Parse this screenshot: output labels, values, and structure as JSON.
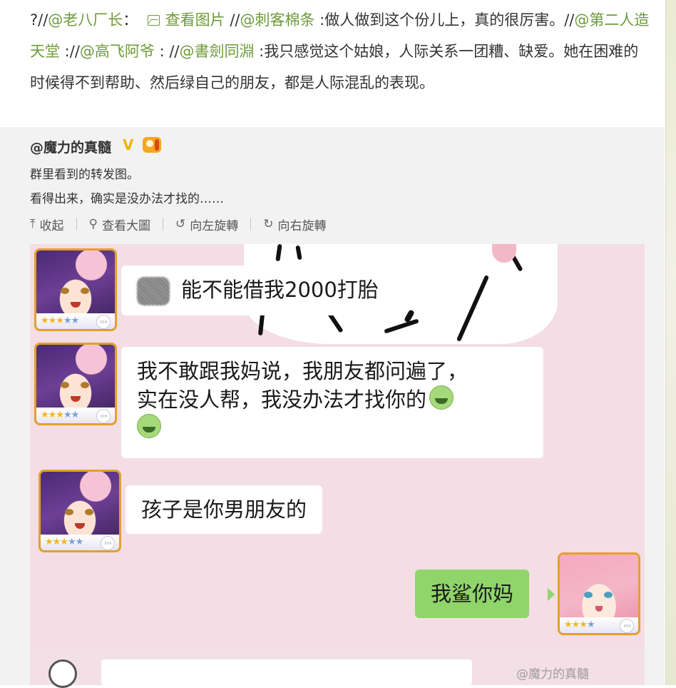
{
  "repost": {
    "prefix": "?//",
    "user1": "@老八厂长",
    "colon1": "：",
    "pic_link": "查看图片",
    "slash2": " //",
    "user2": "@刺客棉条",
    "text2": " :做人做到这个份儿上，真的很厉害。",
    "slash3": "//",
    "user3": "@第二人造天堂",
    "colon3": " ://",
    "user4": "@高飞阿爷",
    "colon4": " : //",
    "user5": "@書劍同淵",
    "text5": " :我只感觉这个姑娘，人际关系一团糟、缺爱。她在困难的时候得不到帮助、然后绿自己的朋友，都是人际混乱的表现。"
  },
  "original": {
    "username": "@魔力的真髓",
    "verified_badge": "V",
    "line1": "群里看到的转发图。",
    "line2": "看得出来，确实是没办法才找的……"
  },
  "toolbar": {
    "collapse": "收起",
    "view_large": "查看大圖",
    "rotate_left": "向左旋轉",
    "rotate_right": "向右旋轉"
  },
  "chat": {
    "messages": [
      {
        "side": "left",
        "text": "能不能借我2000打胎",
        "redacted_prefix": true
      },
      {
        "side": "left",
        "line1": "我不敢跟我妈说，我朋友都问遍了，",
        "line2": "实在没人帮，我没办法才找你的"
      },
      {
        "side": "left",
        "text": "孩子是你男朋友的"
      },
      {
        "side": "right",
        "text": "我鲨你妈"
      }
    ],
    "watermark": "@魔力的真髓"
  },
  "colors": {
    "link": "#6e9a3a",
    "chat_bg": "#f4dde4",
    "bubble_self": "#8fd56a",
    "avatar_border": "#e2a12b",
    "badge": "#f2b200"
  },
  "icons": [
    "image-icon",
    "collapse-arrow-icon",
    "magnifier-icon",
    "rotate-left-icon",
    "rotate-right-icon",
    "emoji-nauseated-icon"
  ]
}
